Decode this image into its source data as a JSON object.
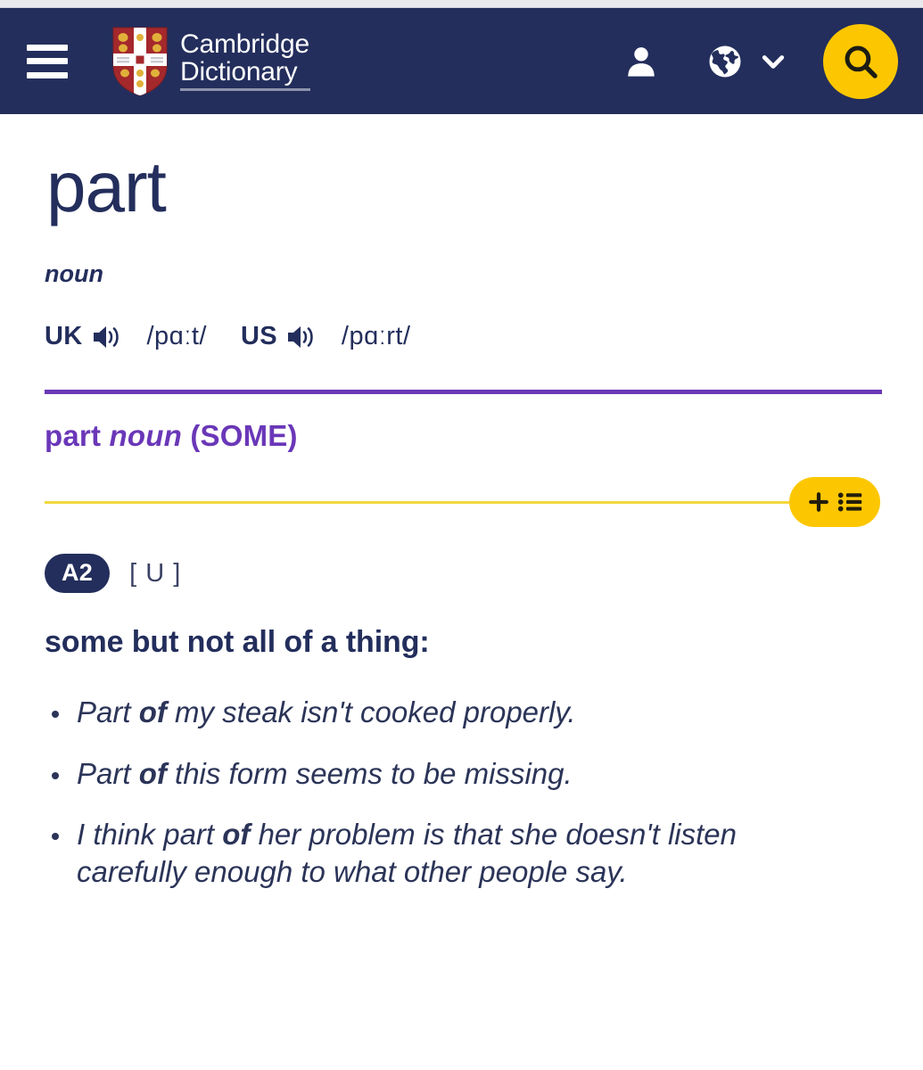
{
  "site": {
    "brand_line1": "Cambridge",
    "brand_line2": "Dictionary",
    "menu_icon": "hamburger-menu-icon",
    "crest_icon": "cambridge-crest-icon",
    "account_icon": "person-icon",
    "language_icon": "globe-icon",
    "language_chevron_icon": "chevron-down-icon",
    "search_icon": "search-icon"
  },
  "entry": {
    "headword": "part",
    "part_of_speech": "noun"
  },
  "pronunciations": [
    {
      "region": "UK",
      "speaker_icon": "speaker-icon",
      "ipa": "/pɑːt/"
    },
    {
      "region": "US",
      "speaker_icon": "speaker-icon",
      "ipa": "/pɑːrt/"
    }
  ],
  "sense": {
    "headword": "part",
    "pos": "noun",
    "guide_word": "(SOME)",
    "level": "A2",
    "grammar_code": "[ U ]",
    "definition": "some but not all of a thing:",
    "add_button": {
      "plus_icon": "plus-icon",
      "list_icon": "bulleted-list-icon"
    },
    "examples": [
      {
        "before": "Part ",
        "bold": "of",
        "after": " my steak isn't cooked properly."
      },
      {
        "before": "Part ",
        "bold": "of",
        "after": " this form seems to be missing."
      },
      {
        "before": "I think part ",
        "bold": "of",
        "after": " her problem is that she doesn't listen carefully enough to what other people say."
      }
    ]
  },
  "colors": {
    "navy": "#232e5c",
    "purple": "#6a37b8",
    "yellow": "#fcc700",
    "yellow_line": "#f2d83c"
  }
}
